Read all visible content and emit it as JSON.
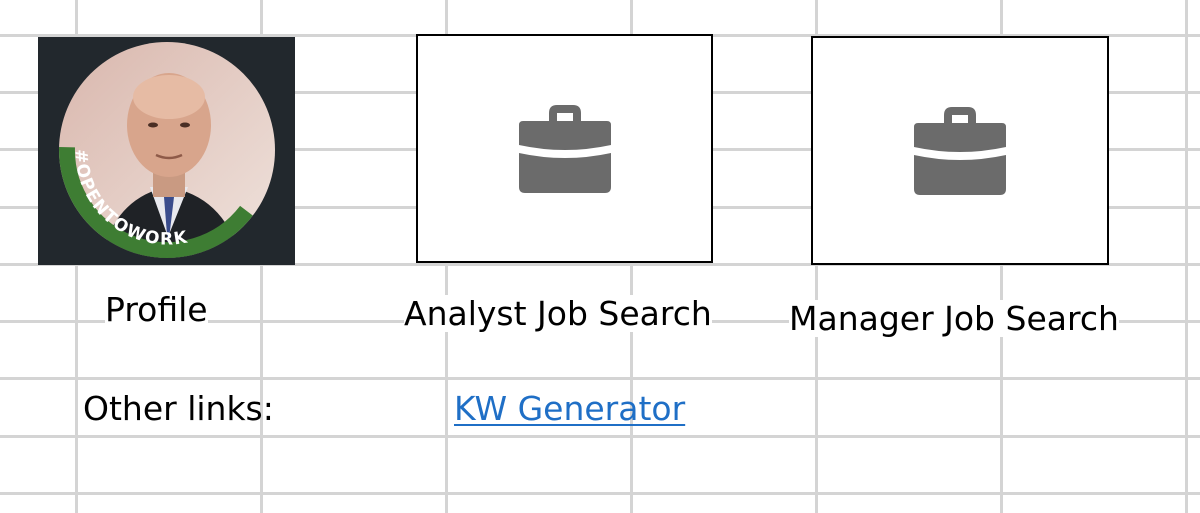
{
  "profile": {
    "caption": "Profile",
    "badge_text": "#OPENTOWORK",
    "badge_color": "#3e7d33",
    "tile_background": "#22282d"
  },
  "analyst": {
    "caption": "Analyst Job Search",
    "icon": "briefcase-icon"
  },
  "manager": {
    "caption": "Manager Job Search",
    "icon": "briefcase-icon"
  },
  "other_links": {
    "label": "Other links:",
    "kw_generator": "KW Generator"
  },
  "colors": {
    "gridline": "#d4d4d4",
    "link": "#1f6fc6",
    "icon": "#6b6b6b"
  }
}
